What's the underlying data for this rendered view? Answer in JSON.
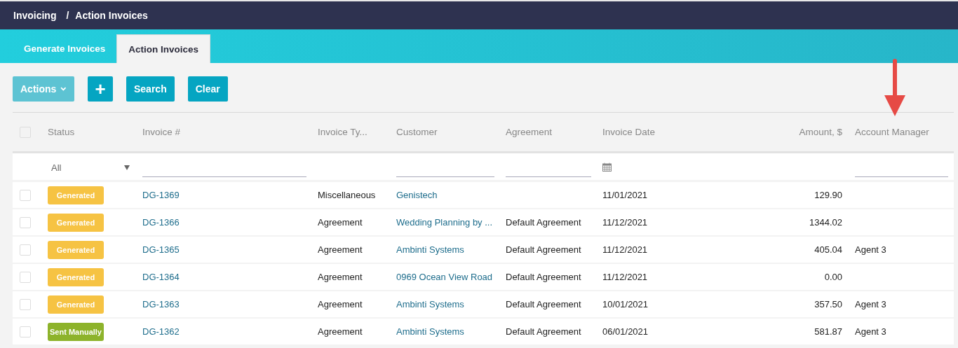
{
  "breadcrumb": [
    {
      "label": "Invoicing"
    },
    {
      "label": "Action Invoices"
    }
  ],
  "breadcrumb_separator": "/",
  "tabs": [
    {
      "label": "Generate Invoices",
      "selected": false
    },
    {
      "label": "Action Invoices",
      "selected": true
    }
  ],
  "toolbar": [
    {
      "kind": "dropdown",
      "label": "Actions",
      "disabled": true
    },
    {
      "kind": "add",
      "label": "+",
      "disabled": false
    },
    {
      "kind": "text",
      "label": "Search",
      "disabled": false
    },
    {
      "kind": "text",
      "label": "Clear",
      "disabled": false
    }
  ],
  "table": {
    "select_all": {
      "checked": false
    },
    "columns": [
      {
        "label": "Status"
      },
      {
        "label": "Invoice #"
      },
      {
        "label": "Invoice Ty..."
      },
      {
        "label": "Customer"
      },
      {
        "label": "Agreement"
      },
      {
        "label": "Invoice Date"
      },
      {
        "label": "Amount, $"
      },
      {
        "label": "Account Manager"
      }
    ],
    "filters": [
      {
        "kind": "select",
        "value": "All"
      },
      {
        "kind": "text"
      },
      {
        "kind": "none"
      },
      {
        "kind": "text"
      },
      {
        "kind": "text"
      },
      {
        "kind": "date"
      },
      {
        "kind": "none"
      },
      {
        "kind": "text"
      }
    ],
    "rows": [
      {
        "checked": false,
        "status": {
          "label": "Generated",
          "color": "#f6c343"
        },
        "invoice": "DG-1369",
        "type": "Miscellaneous",
        "customer": "Genistech",
        "agreement": "",
        "date": "11/01/2021",
        "amount": "129.90",
        "manager": ""
      },
      {
        "checked": false,
        "status": {
          "label": "Generated",
          "color": "#f6c343"
        },
        "invoice": "DG-1366",
        "type": "Agreement",
        "customer": "Wedding Planning by ...",
        "agreement": "Default Agreement",
        "date": "11/12/2021",
        "amount": "1344.02",
        "manager": ""
      },
      {
        "checked": false,
        "status": {
          "label": "Generated",
          "color": "#f6c343"
        },
        "invoice": "DG-1365",
        "type": "Agreement",
        "customer": "Ambinti Systems",
        "agreement": "Default Agreement",
        "date": "11/12/2021",
        "amount": "405.04",
        "manager": "Agent 3"
      },
      {
        "checked": false,
        "status": {
          "label": "Generated",
          "color": "#f6c343"
        },
        "invoice": "DG-1364",
        "type": "Agreement",
        "customer": "0969 Ocean View Road",
        "agreement": "Default Agreement",
        "date": "11/12/2021",
        "amount": "0.00",
        "manager": ""
      },
      {
        "checked": false,
        "status": {
          "label": "Generated",
          "color": "#f6c343"
        },
        "invoice": "DG-1363",
        "type": "Agreement",
        "customer": "Ambinti Systems",
        "agreement": "Default Agreement",
        "date": "10/01/2021",
        "amount": "357.50",
        "manager": "Agent 3"
      },
      {
        "checked": false,
        "status": {
          "label": "Sent Manually",
          "color": "#8db32b"
        },
        "invoice": "DG-1362",
        "type": "Agreement",
        "customer": "Ambinti Systems",
        "agreement": "Default Agreement",
        "date": "06/01/2021",
        "amount": "581.87",
        "manager": "Agent 3"
      }
    ]
  }
}
